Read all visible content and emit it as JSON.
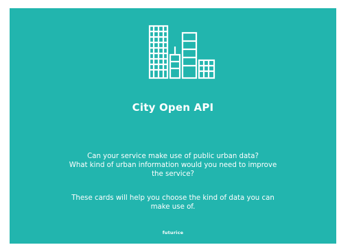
{
  "card": {
    "title": "City  Open API",
    "question_lines": [
      "Can your service make use of public urban data?",
      "What kind of urban information would you need to improve",
      "the service?"
    ],
    "help_lines": [
      "These cards will help you choose the kind of data you can",
      "make use of."
    ],
    "brand": "futurice",
    "illustration_icon": "city-buildings-icon"
  },
  "colors": {
    "background": "#22b5ae",
    "foreground": "#ffffff"
  }
}
